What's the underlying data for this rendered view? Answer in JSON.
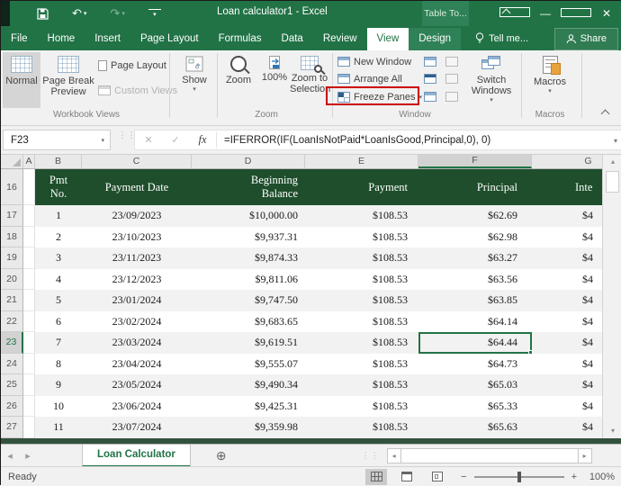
{
  "window": {
    "title": "Loan calculator1 - Excel",
    "context_tab_group": "Table To..."
  },
  "colors": {
    "accent_green": "#217346",
    "table_header_green": "#1e4e2c",
    "highlight_red": "#cc0000",
    "band_gray": "#f2f2f2"
  },
  "icons": {
    "undo": "↶",
    "redo": "↷",
    "dropdown": "▾",
    "cancel": "✕",
    "check": "✓",
    "fx": "fx",
    "up": "▴",
    "down": "▾",
    "left": "◂",
    "right": "▸",
    "add": "⊕",
    "minus": "−",
    "plus": "+",
    "dots": "⋮⋮"
  },
  "ribbon_tabs": {
    "items": [
      "File",
      "Home",
      "Insert",
      "Page Layout",
      "Formulas",
      "Data",
      "Review",
      "View",
      "Design"
    ],
    "active": "View",
    "tell_me": "Tell me...",
    "share": "Share"
  },
  "ribbon": {
    "workbook_views": {
      "label": "Workbook Views",
      "normal": "Normal",
      "page_break_preview": "Page Break Preview",
      "page_layout": "Page Layout",
      "custom_views": "Custom Views"
    },
    "show": {
      "button": "Show"
    },
    "zoom": {
      "label": "Zoom",
      "zoom": "Zoom",
      "hundred": "100%",
      "zoom_to_selection": "Zoom to Selection"
    },
    "window": {
      "label": "Window",
      "new_window": "New Window",
      "arrange_all": "Arrange All",
      "freeze_panes": "Freeze Panes",
      "switch_windows": "Switch Windows"
    },
    "macros": {
      "label": "Macros",
      "button": "Macros"
    }
  },
  "formula_bar": {
    "name_box": "F23",
    "formula": "=IFERROR(IF(LoanIsNotPaid*LoanIsGood,Principal,0), 0)"
  },
  "grid": {
    "col_letters": [
      "A",
      "B",
      "C",
      "D",
      "E",
      "F",
      "G"
    ],
    "selected": {
      "cell": "F23",
      "row": 23,
      "col": "F",
      "col_key": "principal"
    },
    "table_header": {
      "row": 16,
      "pmt": "Pmt No.",
      "date": "Payment Date",
      "balance": "Beginning Balance",
      "payment": "Payment",
      "principal": "Principal",
      "interest": "Inte"
    },
    "rows": [
      {
        "num": 17,
        "pmt": "1",
        "date": "23/09/2023",
        "balance": "$10,000.00",
        "payment": "$108.53",
        "principal": "$62.69",
        "interest": "$4"
      },
      {
        "num": 18,
        "pmt": "2",
        "date": "23/10/2023",
        "balance": "$9,937.31",
        "payment": "$108.53",
        "principal": "$62.98",
        "interest": "$4"
      },
      {
        "num": 19,
        "pmt": "3",
        "date": "23/11/2023",
        "balance": "$9,874.33",
        "payment": "$108.53",
        "principal": "$63.27",
        "interest": "$4"
      },
      {
        "num": 20,
        "pmt": "4",
        "date": "23/12/2023",
        "balance": "$9,811.06",
        "payment": "$108.53",
        "principal": "$63.56",
        "interest": "$4"
      },
      {
        "num": 21,
        "pmt": "5",
        "date": "23/01/2024",
        "balance": "$9,747.50",
        "payment": "$108.53",
        "principal": "$63.85",
        "interest": "$4"
      },
      {
        "num": 22,
        "pmt": "6",
        "date": "23/02/2024",
        "balance": "$9,683.65",
        "payment": "$108.53",
        "principal": "$64.14",
        "interest": "$4"
      },
      {
        "num": 23,
        "pmt": "7",
        "date": "23/03/2024",
        "balance": "$9,619.51",
        "payment": "$108.53",
        "principal": "$64.44",
        "interest": "$4"
      },
      {
        "num": 24,
        "pmt": "8",
        "date": "23/04/2024",
        "balance": "$9,555.07",
        "payment": "$108.53",
        "principal": "$64.73",
        "interest": "$4"
      },
      {
        "num": 25,
        "pmt": "9",
        "date": "23/05/2024",
        "balance": "$9,490.34",
        "payment": "$108.53",
        "principal": "$65.03",
        "interest": "$4"
      },
      {
        "num": 26,
        "pmt": "10",
        "date": "23/06/2024",
        "balance": "$9,425.31",
        "payment": "$108.53",
        "principal": "$65.33",
        "interest": "$4"
      },
      {
        "num": 27,
        "pmt": "11",
        "date": "23/07/2024",
        "balance": "$9,359.98",
        "payment": "$108.53",
        "principal": "$65.63",
        "interest": "$4"
      }
    ]
  },
  "sheet_tabs": {
    "active": "Loan Calculator"
  },
  "status_bar": {
    "mode": "Ready",
    "zoom": "100%"
  }
}
